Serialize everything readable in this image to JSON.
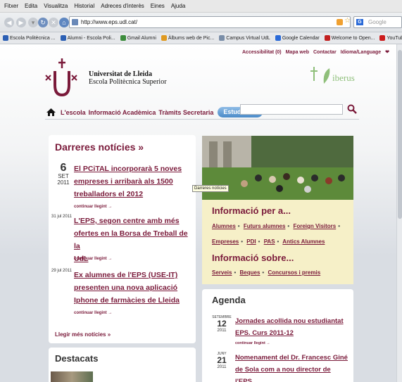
{
  "browser": {
    "menu": [
      "Fitxer",
      "Edita",
      "Visualitza",
      "Historial",
      "Adreces d'interès",
      "Eines",
      "Ajuda"
    ],
    "url": "http://www.eps.udl.cat/",
    "search_placeholder": "Google",
    "bookmarks": [
      {
        "label": "Escola Politècnica ...",
        "icon": "udl-icon",
        "color": "#2b5fb4"
      },
      {
        "label": "Alumni - Escola Poli...",
        "icon": "udl-icon",
        "color": "#2b5fb4"
      },
      {
        "label": "Gmail Alumni",
        "icon": "gmail-icon",
        "color": "#3c8c3c"
      },
      {
        "label": "Àlbums web de Pic...",
        "icon": "picasa-icon",
        "color": "#e09a20"
      },
      {
        "label": "Campus Virtual UdL",
        "icon": "campus-icon",
        "color": "#7a8ea8"
      },
      {
        "label": "Google Calendar",
        "icon": "calendar-icon",
        "color": "#2a6ad8"
      },
      {
        "label": "Welcome to Open...",
        "icon": "opera-icon",
        "color": "#c22020"
      },
      {
        "label": "YouTube - Most vie...",
        "icon": "youtube-icon",
        "color": "#cc1b1b"
      }
    ],
    "more_bookmarks": "»"
  },
  "header": {
    "util_links": [
      "Accessibilitat (0)",
      "Mapa web",
      "Contactar",
      "Idioma/Language"
    ],
    "university": "Universitat de Lleida",
    "school": "Escola Politècnica Superior",
    "partner": "iberus"
  },
  "nav": {
    "items": [
      "L'escola",
      "Informació Acadèmica",
      "Tràmits Secretaria"
    ],
    "estudis": "Estudis",
    "estudis_arrow": "▾"
  },
  "news": {
    "title": "Darreres notícies »",
    "items": [
      {
        "day": "6",
        "month": "SET",
        "year": "2011",
        "lines": [
          "El PCiTAL incorporarà 5 noves",
          "empreses i arribarà als 1500",
          "treballadors el 2012"
        ],
        "more": "continuar llegint →"
      },
      {
        "date": "31 jul 2011",
        "lines": [
          "L'EPS, segon centre amb més",
          "ofertes en la Borsa de Treball de la",
          "UdL"
        ],
        "more": "continuar llegint →"
      },
      {
        "date": "29 jul 2011",
        "lines": [
          "Ex alumnes de l'EPS (USE-IT)",
          "presenten una nova aplicació",
          "Iphone de farmàcies de Lleida"
        ],
        "more": "continuar llegint →"
      }
    ],
    "more_news": "Llegir més notícies »",
    "tooltip": "Darreres notícies"
  },
  "destacats": {
    "title": "Destacats"
  },
  "info": {
    "per_title": "Informació per a...",
    "per_links": [
      "Alumnes",
      "Futurs alumnes",
      "Foreign Visitors",
      "Empreses",
      "PDI",
      "PAS",
      "Antics Alumnes"
    ],
    "sobre_title": "Informació sobre...",
    "sobre_links": [
      "Serveis",
      "Beques",
      "Concursos i premis"
    ],
    "separator": "•"
  },
  "agenda": {
    "title": "Agenda",
    "items": [
      {
        "month": "SETEMBRE",
        "day": "12",
        "year": "2011",
        "lines": [
          "Jornades acollida nou estudiantat",
          "EPS. Curs 2011-12"
        ],
        "more": "continuar llegint →"
      },
      {
        "month": "JUNY",
        "day": "21",
        "year": "2011",
        "lines": [
          "Nomenament del Dr. Francesc Giné",
          "de Sola com a nou director de l'EPS"
        ],
        "more": ""
      }
    ]
  },
  "colors": {
    "brand": "#7a1a3a",
    "info_bg": "#f6f0c8",
    "button": "#4a8ac8"
  }
}
